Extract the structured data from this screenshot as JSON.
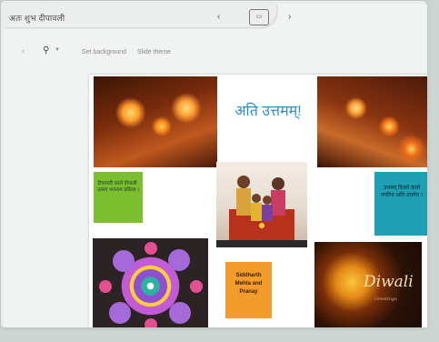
{
  "window": {
    "doc_title": "अतः शुभ दीपावली",
    "nav_prev": "‹",
    "nav_next": "›"
  },
  "toolbar": {
    "back": "‹",
    "zoom_icon": "magnifier-icon",
    "button_1": "Set background",
    "button_2": "Slide theme"
  },
  "slide": {
    "greeting": "अति उत्तमम्!",
    "green_text": "दीपावली काले दीपाली उत्सव भवनाम प्रकिया ।",
    "teal_text": "उत्तमम् दिवसे काले नन्दीपा अति उत्तमेव ।",
    "orange_text": "Siddharth Mehta and Pranay",
    "diwali_title": "Diwali",
    "diwali_sub": "Greetings"
  },
  "colors": {
    "greeting": "#2a8fc4",
    "green_box": "#7bbf2e",
    "teal_box": "#1f9fb3",
    "orange_box": "#f39c2b"
  }
}
